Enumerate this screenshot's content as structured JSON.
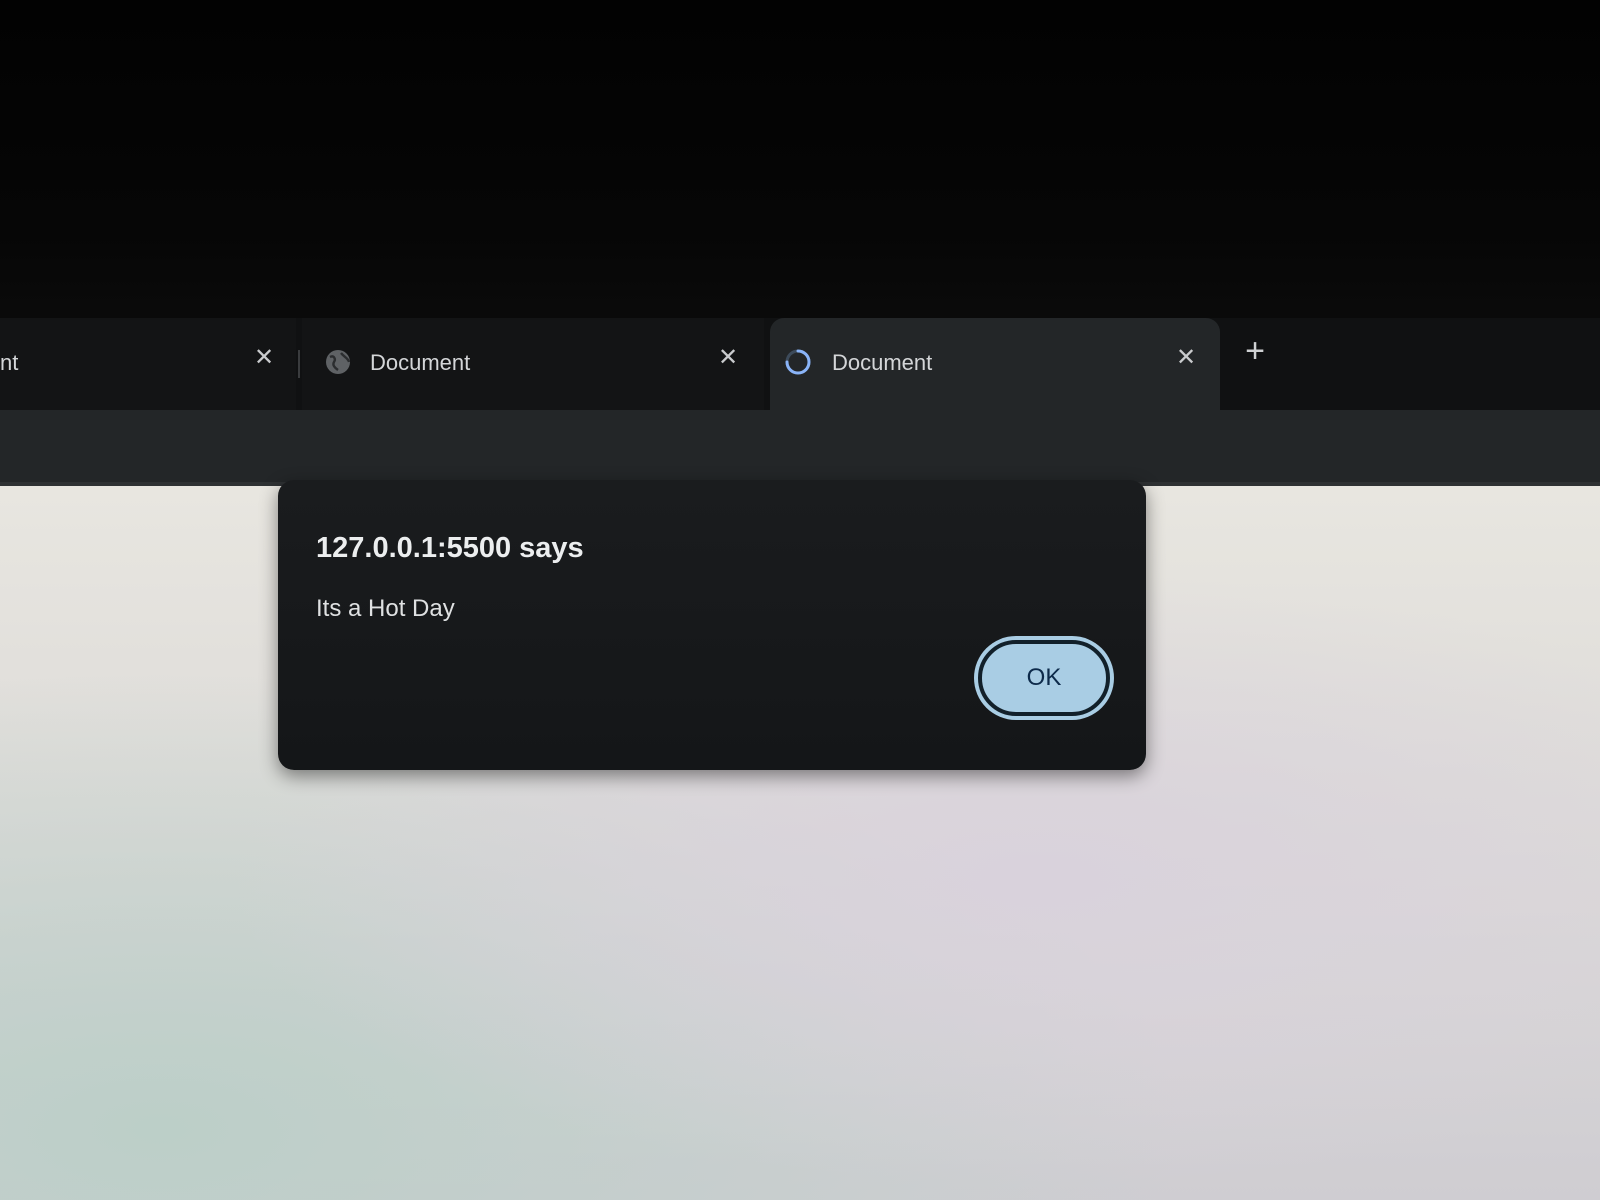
{
  "browser": {
    "tabs": [
      {
        "title": "nt",
        "state": "inactive",
        "close_glyph": "✕"
      },
      {
        "title": "Document",
        "state": "inactive",
        "icon": "globe-icon",
        "close_glyph": "✕"
      },
      {
        "title": "Document",
        "state": "active",
        "icon": "loading-spinner-icon",
        "close_glyph": "✕"
      }
    ],
    "new_tab_glyph": "+"
  },
  "dialog": {
    "title": "127.0.0.1:5500 says",
    "message": "Its a Hot Day",
    "ok_label": "OK"
  },
  "colors": {
    "dialog_bg": "#1a1c1e",
    "ok_button_bg": "#a9cde4",
    "ok_button_text": "#0d2a4a",
    "spinner": "#8ab4f8",
    "page_bg": "#e4e2de"
  }
}
